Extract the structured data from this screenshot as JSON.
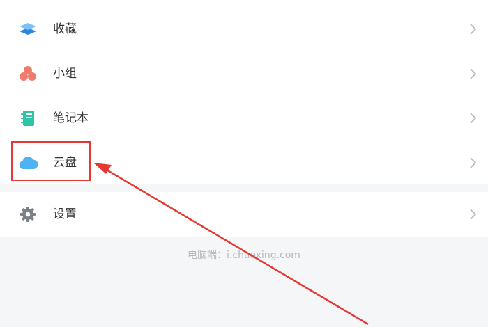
{
  "menu": {
    "items": [
      {
        "label": "收藏",
        "icon": "stacked-layers-icon"
      },
      {
        "label": "小组",
        "icon": "group-circles-icon"
      },
      {
        "label": "笔记本",
        "icon": "notebook-icon"
      },
      {
        "label": "云盘",
        "icon": "cloud-icon"
      }
    ],
    "settings": {
      "label": "设置",
      "icon": "gear-icon"
    }
  },
  "footer": {
    "text": "电脑端：i.chaoxing.com"
  },
  "annotation": {
    "color": "#e53935"
  },
  "colors": {
    "collection": "#2f86e0",
    "group": "#ef7c6c",
    "notebook": "#2fc4a6",
    "cloud": "#4fb3f3",
    "settings": "#7d8187"
  }
}
